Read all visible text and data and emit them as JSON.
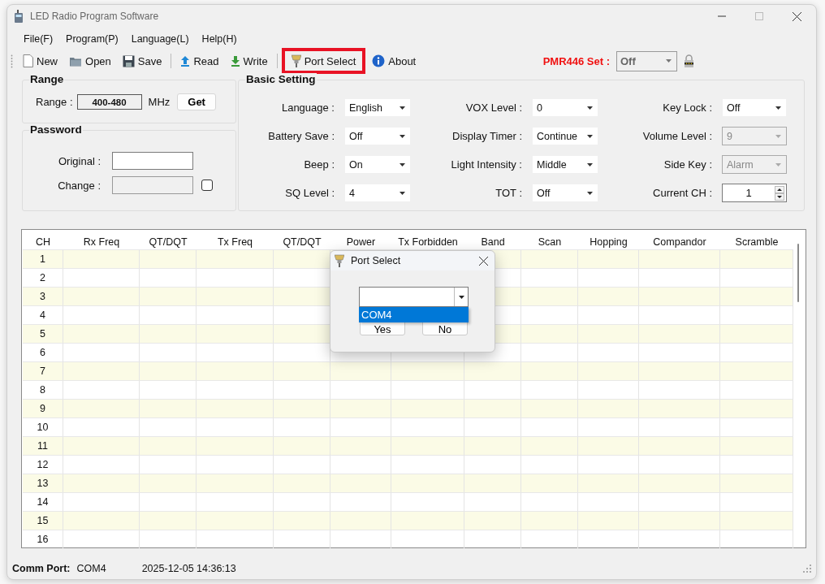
{
  "window": {
    "title": "LED Radio Program Software"
  },
  "menu": [
    {
      "label": "File(F)"
    },
    {
      "label": "Program(P)"
    },
    {
      "label": "Language(L)"
    },
    {
      "label": "Help(H)"
    }
  ],
  "toolbar": [
    {
      "label": "New",
      "highlighted": false
    },
    {
      "label": "Open",
      "highlighted": false
    },
    {
      "label": "Save",
      "highlighted": false
    },
    {
      "label": "Read",
      "highlighted": false
    },
    {
      "label": "Write",
      "highlighted": false
    },
    {
      "label": "Port Select",
      "highlighted": true
    },
    {
      "label": "About",
      "highlighted": false
    }
  ],
  "pmr446": {
    "label": "PMR446 Set :",
    "value": "Off",
    "disabled": true
  },
  "range": {
    "title": "Range",
    "label": "Range :",
    "value": "400-480",
    "unit": "MHz",
    "button": "Get"
  },
  "password": {
    "title": "Password",
    "fields": [
      {
        "label": "Original :",
        "disabled": false
      },
      {
        "label": "Change :",
        "disabled": true
      }
    ],
    "checkbox": {
      "checked": false
    }
  },
  "basic_setting": {
    "title": "Basic Setting",
    "fields": [
      {
        "label": "Language :",
        "value": "English",
        "kind": "select",
        "disabled": false
      },
      {
        "label": "VOX Level :",
        "value": "0",
        "kind": "select",
        "disabled": false
      },
      {
        "label": "Key Lock :",
        "value": "Off",
        "kind": "select",
        "disabled": false
      },
      {
        "label": "Battery Save :",
        "value": "Off",
        "kind": "select",
        "disabled": false
      },
      {
        "label": "Display Timer :",
        "value": "Continue",
        "kind": "select",
        "disabled": false
      },
      {
        "label": "Volume Level :",
        "value": "9",
        "kind": "select",
        "disabled": true
      },
      {
        "label": "Beep :",
        "value": "On",
        "kind": "select",
        "disabled": false
      },
      {
        "label": "Light Intensity :",
        "value": "Middle",
        "kind": "select",
        "disabled": false
      },
      {
        "label": "Side Key :",
        "value": "Alarm",
        "kind": "select",
        "disabled": true
      },
      {
        "label": "SQ Level :",
        "value": "4",
        "kind": "select",
        "disabled": false
      },
      {
        "label": "TOT :",
        "value": "Off",
        "kind": "select",
        "disabled": false
      },
      {
        "label": "Current CH :",
        "value": "1",
        "kind": "spin",
        "disabled": false
      }
    ]
  },
  "table": {
    "columns": [
      "CH",
      "Rx Freq",
      "QT/DQT",
      "Tx Freq",
      "QT/DQT",
      "Power",
      "Tx Forbidden",
      "Band",
      "Scan",
      "Hopping",
      "Compandor",
      "Scramble"
    ],
    "rows": [
      {
        "ch": "1"
      },
      {
        "ch": "2"
      },
      {
        "ch": "3"
      },
      {
        "ch": "4"
      },
      {
        "ch": "5"
      },
      {
        "ch": "6"
      },
      {
        "ch": "7"
      },
      {
        "ch": "8"
      },
      {
        "ch": "9"
      },
      {
        "ch": "10"
      },
      {
        "ch": "11"
      },
      {
        "ch": "12"
      },
      {
        "ch": "13"
      },
      {
        "ch": "14"
      },
      {
        "ch": "15"
      },
      {
        "ch": "16"
      }
    ]
  },
  "dialog": {
    "title": "Port Select",
    "options": [
      {
        "label": "COM4",
        "selected": true
      }
    ],
    "buttons": [
      "Yes",
      "No"
    ]
  },
  "status_bar": {
    "label": "Comm Port:",
    "port": "COM4",
    "datetime": "2025-12-05 14:36:13"
  }
}
